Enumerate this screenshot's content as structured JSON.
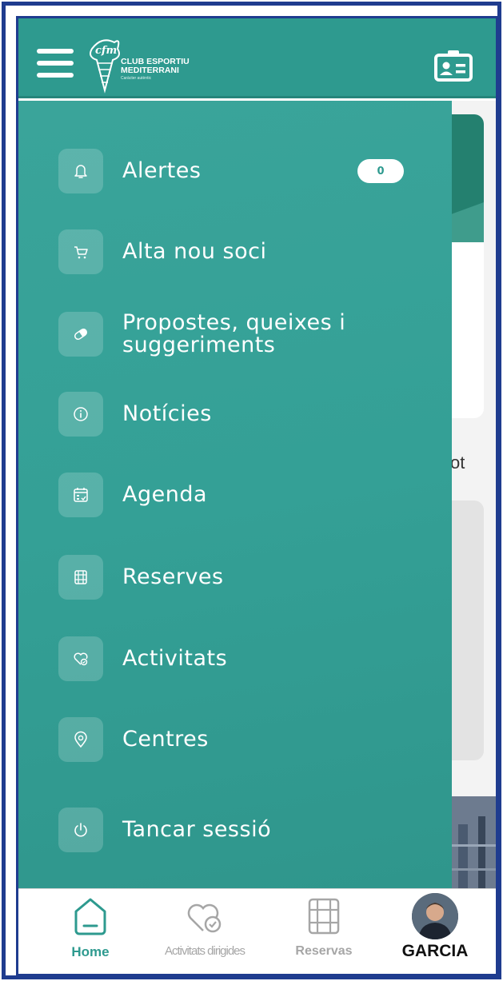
{
  "header": {
    "menu_icon": "hamburger-menu-icon",
    "logo_text_line1": "CLUB ESPORTIU",
    "logo_text_line2": "MEDITERRANI",
    "logo_subtitle": "Caràcter autèntic",
    "membership_card_icon": "id-card-icon",
    "colors": {
      "primary": "#2e9a8f",
      "drawer": "#34a096",
      "frame": "#1f3c8f"
    }
  },
  "background": {
    "partial_text": "ot"
  },
  "drawer": {
    "items": [
      {
        "label": "Alertes",
        "icon": "bell-icon",
        "badge": "0"
      },
      {
        "label": "Alta nou soci",
        "icon": "cart-icon"
      },
      {
        "label": "Propostes, queixes i\nsuggeriments",
        "icon": "pill-icon"
      },
      {
        "label": "Notícies",
        "icon": "info-icon"
      },
      {
        "label": "Agenda",
        "icon": "calendar-icon"
      },
      {
        "label": "Reserves",
        "icon": "film-icon"
      },
      {
        "label": "Activitats",
        "icon": "heart-check-icon"
      },
      {
        "label": "Centres",
        "icon": "location-pin-icon"
      },
      {
        "label": "Tancar sessió",
        "icon": "power-icon"
      }
    ]
  },
  "bottom_nav": {
    "tabs": [
      {
        "label": "Home",
        "icon": "home-icon",
        "active": true
      },
      {
        "label": "Activitats dirigides",
        "icon": "heart-check-icon",
        "active": false
      },
      {
        "label": "Reservas",
        "icon": "film-icon",
        "active": false
      },
      {
        "label": "GARCIA",
        "icon": "avatar",
        "active": false
      }
    ]
  }
}
